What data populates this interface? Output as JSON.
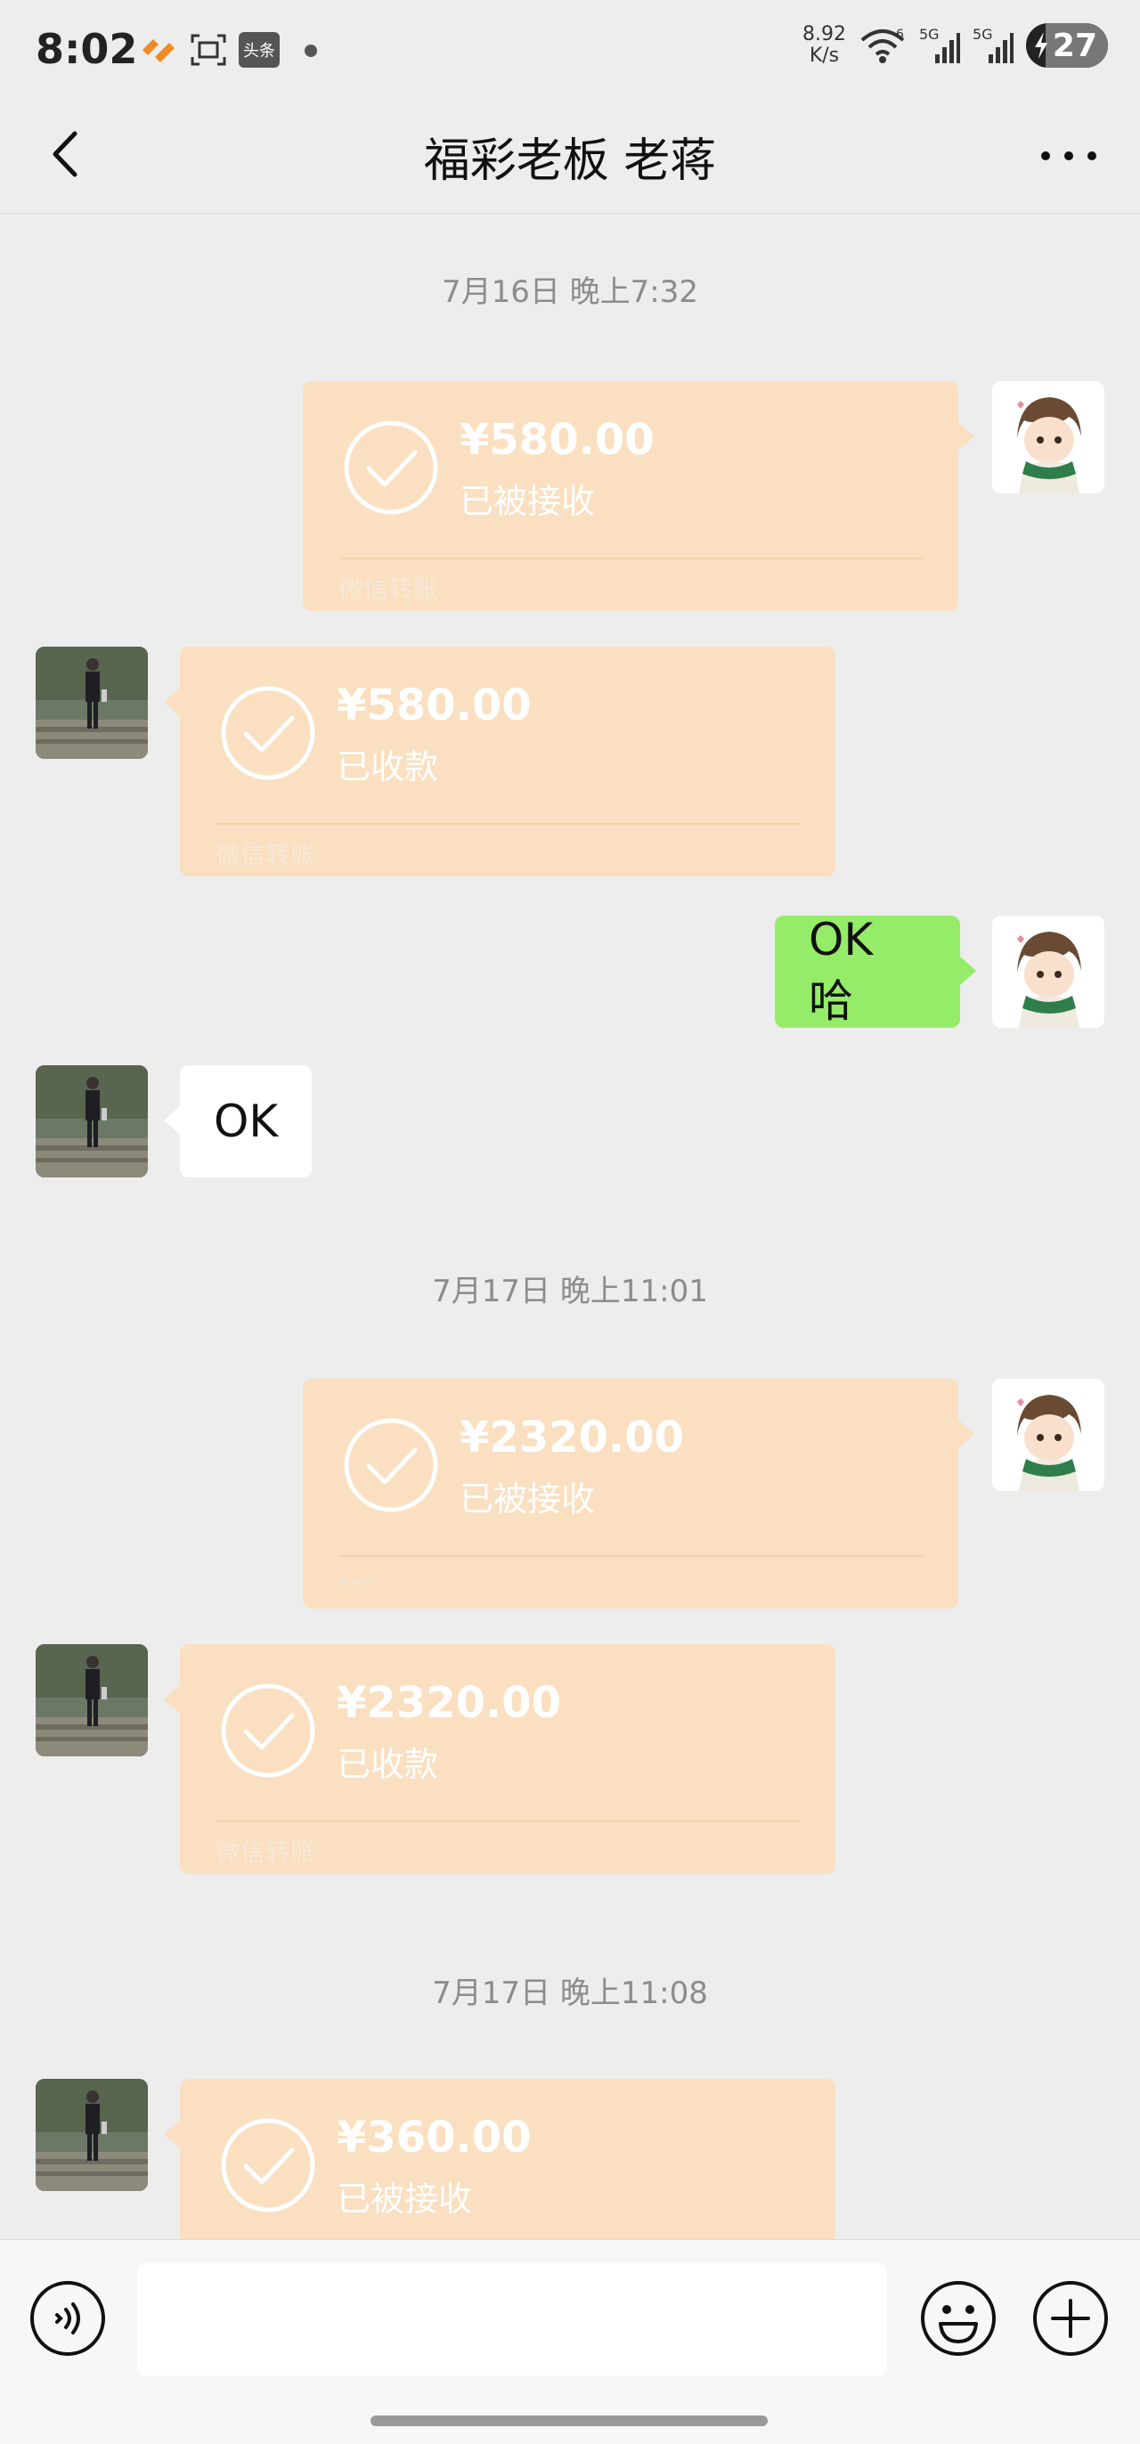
{
  "status_bar": {
    "time": "8:02",
    "net_speed_value": "8.92",
    "net_speed_unit": "K/s",
    "signal_label_1": "5G",
    "signal_label_2": "5G",
    "battery": "27",
    "toutiao_label": "头条",
    "wifi_badge": "6"
  },
  "header": {
    "title": "福彩老板 老蒋"
  },
  "messages": {
    "ts1": "7月16日 晚上7:32",
    "m1": {
      "amount": "¥580.00",
      "status": "已被接收",
      "footer": "微信转账"
    },
    "m2": {
      "amount": "¥580.00",
      "status": "已收款",
      "footer": "微信转账"
    },
    "m3": {
      "text": "OK 哈"
    },
    "m4": {
      "text": "OK"
    },
    "ts2": "7月17日 晚上11:01",
    "m5": {
      "amount": "¥2320.00",
      "status": "已被接收"
    },
    "m6": {
      "amount": "¥2320.00",
      "status": "已收款",
      "footer": "微信转账"
    },
    "ts3": "7月17日 晚上11:08",
    "m7": {
      "amount": "¥360.00",
      "status": "已被接收"
    }
  },
  "input": {
    "placeholder": "",
    "value": ""
  },
  "icons": {
    "back": "chevron-left-icon",
    "more": "more-dots-icon",
    "voice": "voice-icon",
    "emoji": "emoji-icon",
    "plus": "plus-icon",
    "check": "check-circle-icon"
  },
  "colors": {
    "transfer_bubble": "#fadfc0",
    "my_text_bubble": "#95ec69",
    "other_text_bubble": "#ffffff",
    "background": "#ededed"
  }
}
